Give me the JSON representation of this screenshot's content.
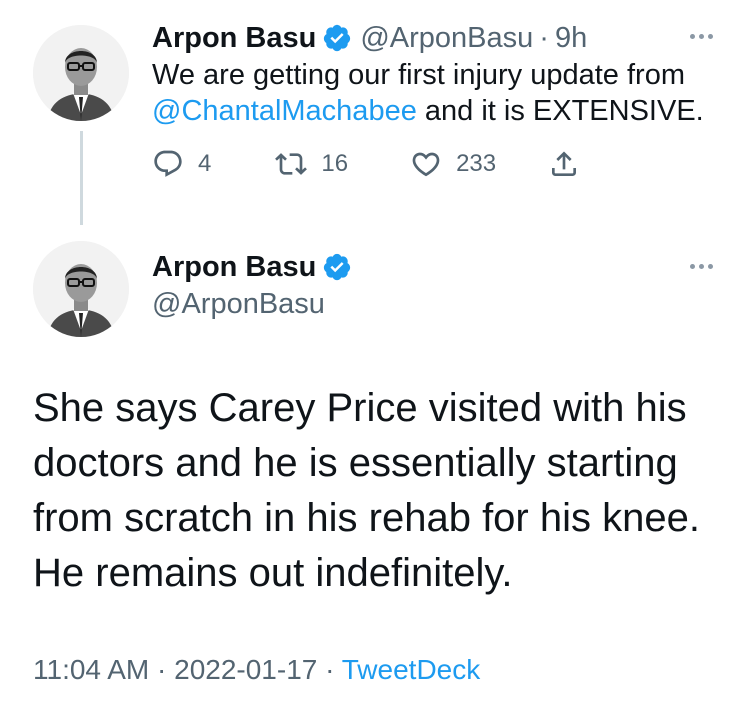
{
  "tweet1": {
    "author_name": "Arpon Basu",
    "handle": "@ArponBasu",
    "separator": "·",
    "age": "9h",
    "text_before": "We are getting our first injury update from ",
    "mention": "@ChantalMachabee",
    "text_after": " and it is EXTENSIVE.",
    "replies": "4",
    "retweets": "16",
    "likes": "233"
  },
  "tweet2": {
    "author_name": "Arpon Basu",
    "handle": "@ArponBasu",
    "text": "She says Carey Price visited with his doctors and he is essentially starting from scratch in his rehab for his knee. He remains out indefinitely.",
    "time": "11:04 AM",
    "sep1": " · ",
    "date": "2022-01-17",
    "sep2": " · ",
    "source": "TweetDeck"
  },
  "colors": {
    "accent": "#1d9bf0",
    "text_primary": "#0f1419",
    "text_secondary": "#536471",
    "thread_line": "#cfd9de"
  },
  "icons": [
    "verified-badge-icon",
    "more-options-icon",
    "reply-icon",
    "retweet-icon",
    "like-icon",
    "share-icon",
    "avatar-photo"
  ]
}
